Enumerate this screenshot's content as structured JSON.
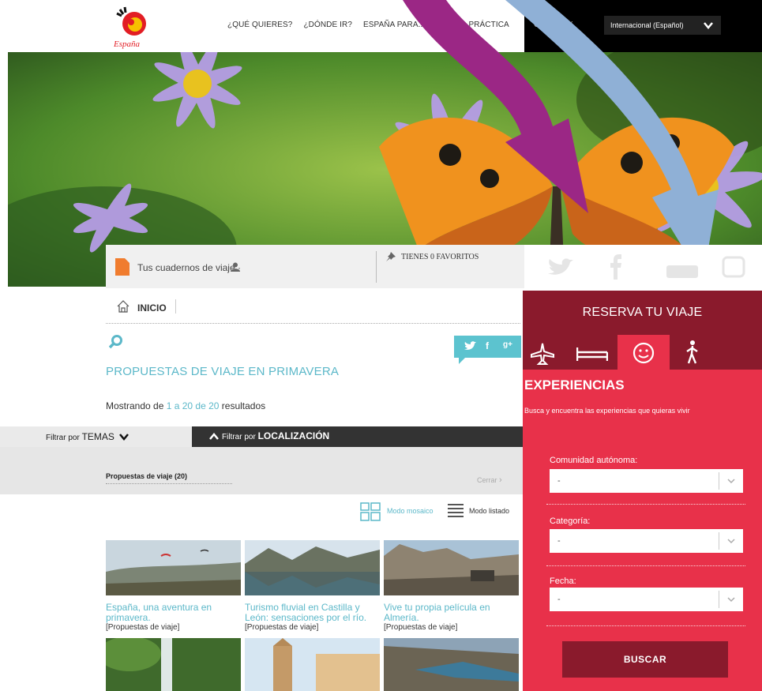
{
  "header": {
    "logo_text": "España",
    "nav": [
      "¿QUÉ QUIERES?",
      "¿DÓNDE IR?",
      "ESPAÑA PARA...",
      "INFO PRÁCTICA"
    ],
    "country_link": "COUNTRY",
    "language": "Internacional (Español)"
  },
  "notebook": {
    "label": "Tus cuadernos de viaje ·",
    "favorites": "TIENES 0 FAVORITOS"
  },
  "breadcrumb": {
    "home": "INICIO"
  },
  "share": {
    "twitter": "t",
    "facebook": "f",
    "gplus": "g+"
  },
  "page_title": "PROPUESTAS DE VIAJE EN PRIMAVERA",
  "results": {
    "prefix": "Mostrando de ",
    "range": "1 a 20 de 20",
    "suffix": " resultados"
  },
  "filters": {
    "by_topic_prefix": "Filtrar por ",
    "by_topic": "TEMAS",
    "by_location_prefix": "Filtrar por ",
    "by_location": "LOCALIZACIÓN",
    "panel_label": "Propuestas de viaje (20)",
    "close": "Cerrar"
  },
  "view_modes": {
    "mosaic": "Modo mosaico",
    "list": "Modo listado"
  },
  "cards": [
    {
      "title": "España, una aventura en primavera.",
      "category": "[Propuestas de viaje]"
    },
    {
      "title": "Turismo fluvial en Castilla y León: sensaciones por el río.",
      "category": "[Propuestas de viaje]"
    },
    {
      "title": "Vive tu propia película en Almería.",
      "category": "[Propuestas de viaje]"
    }
  ],
  "booking": {
    "title": "RESERVA TU VIAJE",
    "section_title": "EXPERIENCIAS",
    "description": "Busca y encuentra las experiencias que quieras vivir",
    "fields": [
      {
        "label": "Comunidad autónoma:",
        "value": "-"
      },
      {
        "label": "Categoría:",
        "value": "-"
      },
      {
        "label": "Fecha:",
        "value": "-"
      }
    ],
    "submit": "BUSCAR"
  },
  "colors": {
    "accent": "#5cb8c9",
    "booking_red": "#e8314a",
    "booking_dark": "#8a1a2c",
    "arrow_purple": "#9b2785",
    "arrow_blue": "#8fb0d6"
  }
}
